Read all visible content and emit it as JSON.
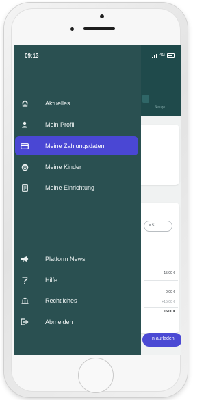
{
  "status_bar": {
    "time": "09:13",
    "network": "4G"
  },
  "drawer": {
    "items": [
      {
        "label": "Aktuelles",
        "icon": "home-icon"
      },
      {
        "label": "Mein Profil",
        "icon": "person-icon"
      },
      {
        "label": "Meine Zahlungsdaten",
        "icon": "credit-card-icon",
        "active": true
      },
      {
        "label": "Meine Kinder",
        "icon": "child-face-icon"
      },
      {
        "label": "Meine Einrichtung",
        "icon": "document-icon"
      }
    ],
    "bottom_items": [
      {
        "label": "Platform News",
        "icon": "megaphone-icon"
      },
      {
        "label": "Hilfe",
        "icon": "help-icon"
      },
      {
        "label": "Rechtliches",
        "icon": "bank-icon"
      },
      {
        "label": "Abmelden",
        "icon": "logout-icon"
      }
    ],
    "accent": "#4a47d4",
    "background": "#2a5051"
  },
  "background_app": {
    "tab_label": "...fkauge",
    "amount_input": "5 €",
    "amounts": [
      "15,00 €",
      "0,00 €",
      "+15,00 €",
      "15,00 €"
    ],
    "button_label": "n aufladen"
  }
}
